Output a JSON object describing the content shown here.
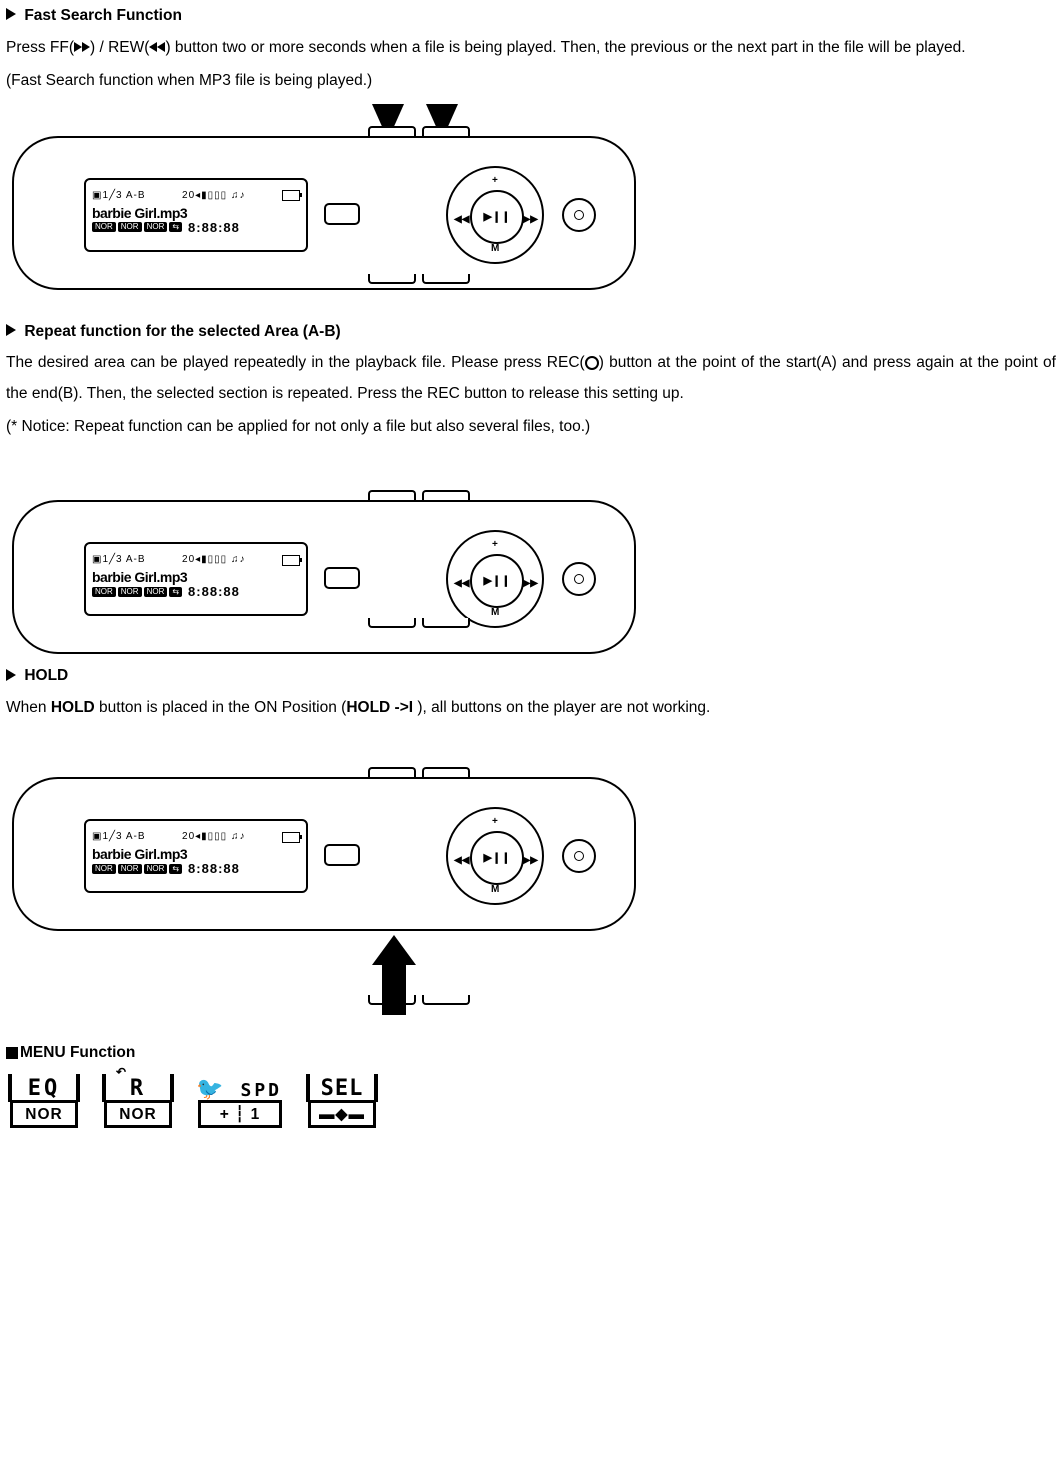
{
  "sections": {
    "fast_search": {
      "title": "Fast Search Function",
      "p1a": "Press FF(",
      "p1b": ") / REW(",
      "p1c": ") button two or more seconds when a file is being played. Then, the previous or the next part in the file will be played.",
      "p2": "(Fast Search function when MP3 file is being played.)"
    },
    "repeat": {
      "title": "Repeat function for the selected Area (A-B)",
      "p1a": "The desired area can be played repeatedly in the playback file. Please press REC(",
      "p1b": ") button at the point of the start(A) and press again at the point of the end(B). Then, the selected section is repeated.  Press the REC button to release this setting up.",
      "p2": "(* Notice: Repeat function can be applied for not only a file but also several files, too.)"
    },
    "hold": {
      "title": "HOLD",
      "p1a": "When ",
      "hold1": "HOLD",
      "p1b": " button is placed in the ON Position (",
      "hold2": "HOLD ->I ",
      "p1c": "), all buttons on the player are not working."
    },
    "menu": {
      "title": "MENU Function"
    }
  },
  "device_lcd": {
    "top_line_left": "▣1╱3  A-B",
    "top_line_mid": "20◂▮▯▯▯  ♫♪",
    "track": "barbie Girl.mp3",
    "tag": "NOR",
    "shuffle": "⇆",
    "digits": "8:88:88"
  },
  "dial": {
    "center": "▶❙❙",
    "left": "◀◀",
    "right": "▶▶",
    "top": "+",
    "bottom": "M"
  },
  "menu_icons": {
    "eq_top": "EQ",
    "eq_bot": "NOR",
    "r_top": "R",
    "r_bot": "NOR",
    "spd_top": "SPD",
    "spd_bot": "+ ┆ 1",
    "sel_top": "SEL",
    "sel_bot": "▬◆▬"
  }
}
